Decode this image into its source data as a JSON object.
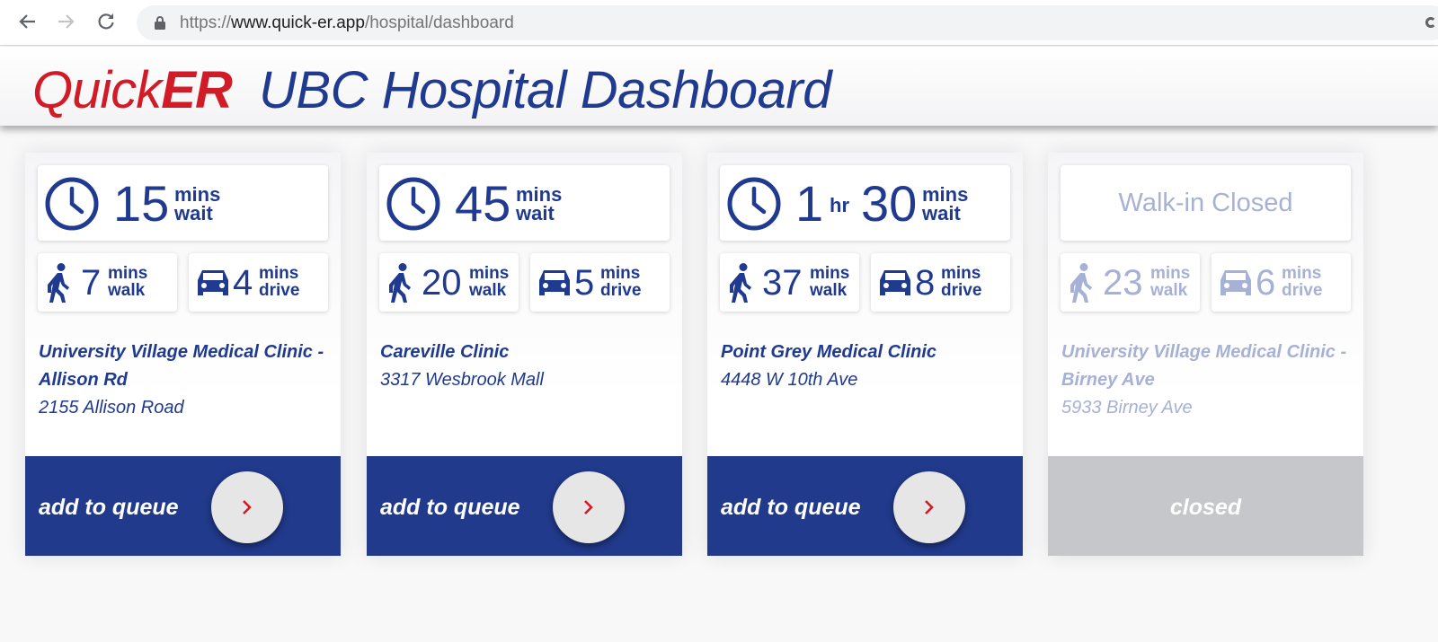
{
  "browser": {
    "url_prefix": "https://",
    "url_host": "www.quick-er.app",
    "url_path": "/hospital/dashboard",
    "icons": [
      "back-arrow-icon",
      "forward-arrow-icon",
      "reload-icon",
      "lock-icon"
    ]
  },
  "header": {
    "brand_quick": "Quick",
    "brand_er": "ER",
    "title": "UBC Hospital Dashboard"
  },
  "colors": {
    "brand_red": "#d11b26",
    "primary_blue": "#213a8c",
    "faded_blue": "#a7b1d6",
    "closed_gray": "#c6c7cb"
  },
  "cards": [
    {
      "status": "open",
      "wait_hours": "",
      "hr_unit": "",
      "wait_mins": "15",
      "wait_unit_top": "mins",
      "wait_unit_bottom": "wait",
      "walk": "7",
      "walk_unit_top": "mins",
      "walk_unit_bottom": "walk",
      "drive": "4",
      "drive_unit_top": "mins",
      "drive_unit_bottom": "drive",
      "name": "University Village Medical Clinic - Allison Rd",
      "address": "2155 Allison Road",
      "action_label": "add to queue"
    },
    {
      "status": "open",
      "wait_hours": "",
      "hr_unit": "",
      "wait_mins": "45",
      "wait_unit_top": "mins",
      "wait_unit_bottom": "wait",
      "walk": "20",
      "walk_unit_top": "mins",
      "walk_unit_bottom": "walk",
      "drive": "5",
      "drive_unit_top": "mins",
      "drive_unit_bottom": "drive",
      "name": "Careville Clinic",
      "address": "3317 Wesbrook Mall",
      "action_label": "add to queue"
    },
    {
      "status": "open",
      "wait_hours": "1",
      "hr_unit": "hr",
      "wait_mins": "30",
      "wait_unit_top": "mins",
      "wait_unit_bottom": "wait",
      "walk": "37",
      "walk_unit_top": "mins",
      "walk_unit_bottom": "walk",
      "drive": "8",
      "drive_unit_top": "mins",
      "drive_unit_bottom": "drive",
      "name": "Point Grey Medical Clinic",
      "address": "4448 W 10th Ave",
      "action_label": "add to queue"
    },
    {
      "status": "closed",
      "closed_message": "Walk-in Closed",
      "walk": "23",
      "walk_unit_top": "mins",
      "walk_unit_bottom": "walk",
      "drive": "6",
      "drive_unit_top": "mins",
      "drive_unit_bottom": "drive",
      "name": "University Village Medical Clinic - Birney Ave",
      "address": "5933 Birney Ave",
      "action_label": "closed"
    }
  ]
}
